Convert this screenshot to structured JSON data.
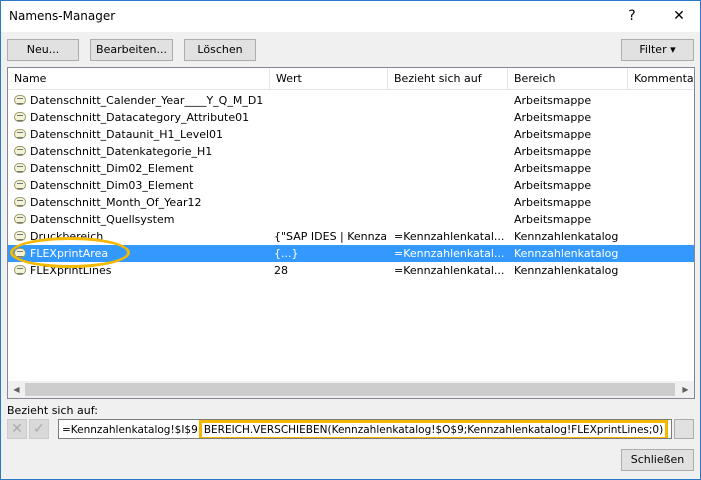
{
  "window": {
    "title": "Namens-Manager",
    "help": "?",
    "close": "✕"
  },
  "toolbar": {
    "new": "Neu...",
    "edit": "Bearbeiten...",
    "delete": "Löschen",
    "filter": "Filter ▾"
  },
  "columns": [
    "Name",
    "Wert",
    "Bezieht sich auf",
    "Bereich",
    "Kommentar"
  ],
  "rows": [
    {
      "name": "Datenschnitt_Calender_Year____Y_Q_M_D1",
      "value": "",
      "refers": "",
      "scope": "Arbeitsmappe"
    },
    {
      "name": "Datenschnitt_Datacategory_Attribute01",
      "value": "",
      "refers": "",
      "scope": "Arbeitsmappe"
    },
    {
      "name": "Datenschnitt_Dataunit_H1_Level01",
      "value": "",
      "refers": "",
      "scope": "Arbeitsmappe"
    },
    {
      "name": "Datenschnitt_Datenkategorie_H1",
      "value": "",
      "refers": "",
      "scope": "Arbeitsmappe"
    },
    {
      "name": "Datenschnitt_Dim02_Element",
      "value": "",
      "refers": "",
      "scope": "Arbeitsmappe"
    },
    {
      "name": "Datenschnitt_Dim03_Element",
      "value": "",
      "refers": "",
      "scope": "Arbeitsmappe"
    },
    {
      "name": "Datenschnitt_Month_Of_Year12",
      "value": "",
      "refers": "",
      "scope": "Arbeitsmappe"
    },
    {
      "name": "Datenschnitt_Quellsystem",
      "value": "",
      "refers": "",
      "scope": "Arbeitsmappe"
    },
    {
      "name": "Druckbereich",
      "value": "{\"SAP IDES | Kennza...",
      "refers": "=Kennzahlenkatal...",
      "scope": "Kennzahlenkatalog"
    },
    {
      "name": "FLEXprintArea",
      "value": "{...}",
      "refers": "=Kennzahlenkatal...",
      "scope": "Kennzahlenkatalog",
      "selected": true
    },
    {
      "name": "FLEXprintLines",
      "value": "28",
      "refers": "=Kennzahlenkatal...",
      "scope": "Kennzahlenkatalog"
    }
  ],
  "refers_to": {
    "label": "Bezieht sich auf:",
    "prefix": "=Kennzahlenkatalog!$I$9",
    "highlighted": "BEREICH.VERSCHIEBEN(Kennzahlenkatalog!$O$9;Kennzahlenkatalog!FLEXprintLines;0)"
  },
  "close_button": "Schließen",
  "colors": {
    "selection": "#3399ff",
    "highlight": "#f5b800"
  }
}
